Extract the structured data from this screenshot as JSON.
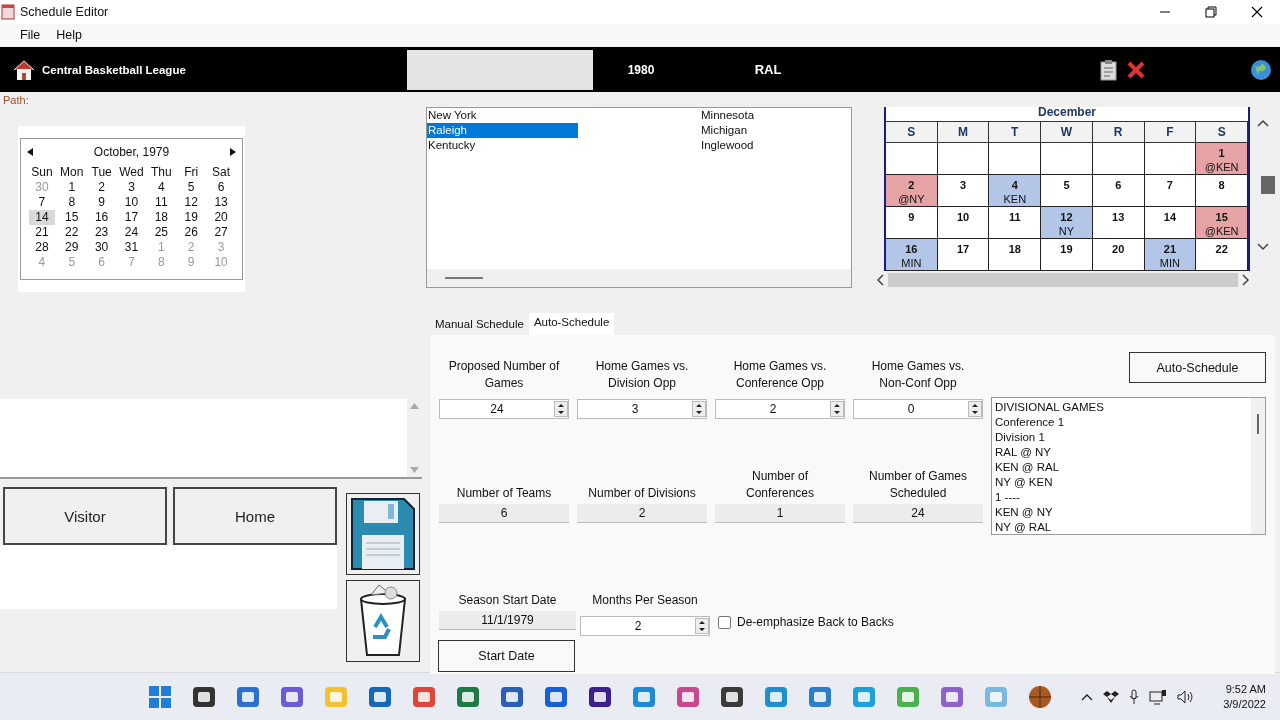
{
  "window": {
    "title": "Schedule Editor"
  },
  "menu": [
    "File",
    "Help"
  ],
  "header": {
    "league": "Central Basketball League",
    "year": "1980",
    "team": "RAL"
  },
  "path_label": "Path:",
  "mini_calendar": {
    "title": "October, 1979",
    "weekdays": [
      "Sun",
      "Mon",
      "Tue",
      "Wed",
      "Thu",
      "Fri",
      "Sat"
    ],
    "days": [
      {
        "day": "30",
        "outside_month": true,
        "selected": false
      },
      {
        "day": "1",
        "outside_month": false,
        "selected": false
      },
      {
        "day": "2",
        "outside_month": false,
        "selected": false
      },
      {
        "day": "3",
        "outside_month": false,
        "selected": false
      },
      {
        "day": "4",
        "outside_month": false,
        "selected": false
      },
      {
        "day": "5",
        "outside_month": false,
        "selected": false
      },
      {
        "day": "6",
        "outside_month": false,
        "selected": false
      },
      {
        "day": "7",
        "outside_month": false,
        "selected": false
      },
      {
        "day": "8",
        "outside_month": false,
        "selected": false
      },
      {
        "day": "9",
        "outside_month": false,
        "selected": false
      },
      {
        "day": "10",
        "outside_month": false,
        "selected": false
      },
      {
        "day": "11",
        "outside_month": false,
        "selected": false
      },
      {
        "day": "12",
        "outside_month": false,
        "selected": false
      },
      {
        "day": "13",
        "outside_month": false,
        "selected": false
      },
      {
        "day": "14",
        "outside_month": false,
        "selected": true
      },
      {
        "day": "15",
        "outside_month": false,
        "selected": false
      },
      {
        "day": "16",
        "outside_month": false,
        "selected": false
      },
      {
        "day": "17",
        "outside_month": false,
        "selected": false
      },
      {
        "day": "18",
        "outside_month": false,
        "selected": false
      },
      {
        "day": "19",
        "outside_month": false,
        "selected": false
      },
      {
        "day": "20",
        "outside_month": false,
        "selected": false
      },
      {
        "day": "21",
        "outside_month": false,
        "selected": false
      },
      {
        "day": "22",
        "outside_month": false,
        "selected": false
      },
      {
        "day": "23",
        "outside_month": false,
        "selected": false
      },
      {
        "day": "24",
        "outside_month": false,
        "selected": false
      },
      {
        "day": "25",
        "outside_month": false,
        "selected": false
      },
      {
        "day": "26",
        "outside_month": false,
        "selected": false
      },
      {
        "day": "27",
        "outside_month": false,
        "selected": false
      },
      {
        "day": "28",
        "outside_month": false,
        "selected": false
      },
      {
        "day": "29",
        "outside_month": false,
        "selected": false
      },
      {
        "day": "30",
        "outside_month": false,
        "selected": false
      },
      {
        "day": "31",
        "outside_month": false,
        "selected": false
      },
      {
        "day": "1",
        "outside_month": true,
        "selected": false
      },
      {
        "day": "2",
        "outside_month": true,
        "selected": false
      },
      {
        "day": "3",
        "outside_month": true,
        "selected": false
      },
      {
        "day": "4",
        "outside_month": true,
        "selected": false
      },
      {
        "day": "5",
        "outside_month": true,
        "selected": false
      },
      {
        "day": "6",
        "outside_month": true,
        "selected": false
      },
      {
        "day": "7",
        "outside_month": true,
        "selected": false
      },
      {
        "day": "8",
        "outside_month": true,
        "selected": false
      },
      {
        "day": "9",
        "outside_month": true,
        "selected": false
      },
      {
        "day": "10",
        "outside_month": true,
        "selected": false
      }
    ]
  },
  "team_columns": [
    [
      {
        "name": "New York",
        "selected": false
      },
      {
        "name": "Raleigh",
        "selected": true
      },
      {
        "name": "Kentucky",
        "selected": false
      }
    ],
    [
      {
        "name": "Minnesota",
        "selected": false
      },
      {
        "name": "Michigan",
        "selected": false
      },
      {
        "name": "Inglewood",
        "selected": false
      }
    ]
  ],
  "month_calendar": {
    "title": "December",
    "weekdays": [
      "S",
      "M",
      "T",
      "W",
      "R",
      "F",
      "S"
    ],
    "cells": [
      {
        "kind": "blank"
      },
      {
        "kind": "blank"
      },
      {
        "kind": "blank"
      },
      {
        "kind": "blank"
      },
      {
        "kind": "blank"
      },
      {
        "kind": "blank"
      },
      {
        "kind": "away",
        "day": "1",
        "game": "@KEN"
      },
      {
        "kind": "away",
        "day": "2",
        "game": "@NY"
      },
      {
        "kind": "open",
        "day": "3"
      },
      {
        "kind": "home",
        "day": "4",
        "game": "KEN"
      },
      {
        "kind": "open",
        "day": "5"
      },
      {
        "kind": "open",
        "day": "6"
      },
      {
        "kind": "open",
        "day": "7"
      },
      {
        "kind": "open",
        "day": "8"
      },
      {
        "kind": "open",
        "day": "9"
      },
      {
        "kind": "open",
        "day": "10"
      },
      {
        "kind": "open",
        "day": "11"
      },
      {
        "kind": "home",
        "day": "12",
        "game": "NY"
      },
      {
        "kind": "open",
        "day": "13"
      },
      {
        "kind": "open",
        "day": "14"
      },
      {
        "kind": "away",
        "day": "15",
        "game": "@KEN"
      },
      {
        "kind": "home",
        "day": "16",
        "game": "MIN"
      },
      {
        "kind": "open",
        "day": "17"
      },
      {
        "kind": "open",
        "day": "18"
      },
      {
        "kind": "open",
        "day": "19"
      },
      {
        "kind": "open",
        "day": "20"
      },
      {
        "kind": "home",
        "day": "21",
        "game": "MIN"
      },
      {
        "kind": "open",
        "day": "22"
      }
    ]
  },
  "side_buttons": [
    "Visitor",
    "Home"
  ],
  "tabs": [
    {
      "label": "Manual Schedule",
      "selected": false
    },
    {
      "label": "Auto-Schedule",
      "selected": true
    }
  ],
  "auto_schedule": {
    "spinners": [
      {
        "label": "Proposed Number of Games",
        "value": "24"
      },
      {
        "label": "Home Games vs. Division Opp",
        "value": "3"
      },
      {
        "label": "Home Games vs. Conference Opp",
        "value": "2"
      },
      {
        "label": "Home Games vs. Non-Conf Opp",
        "value": "0"
      }
    ],
    "stats": [
      {
        "label": "Number of Teams",
        "value": "6"
      },
      {
        "label": "Number of Divisions",
        "value": "2"
      },
      {
        "label": "Number of Conferences",
        "value": "1"
      },
      {
        "label": "Number of Games Scheduled",
        "value": "24"
      }
    ],
    "season_start": {
      "label": "Season Start Date",
      "value": "11/1/1979"
    },
    "months": {
      "label": "Months Per Season",
      "value": "2"
    },
    "back_to_backs": {
      "label": "De-emphasize Back to Backs",
      "checked": false
    },
    "start_date_button": "Start Date",
    "auto_schedule_button": "Auto-Schedule",
    "games": [
      "DIVISIONAL GAMES",
      "Conference 1",
      "Division 1",
      "RAL @ NY",
      "KEN @ RAL",
      "NY @ KEN",
      "1 ----",
      "KEN @ NY",
      "NY @ RAL"
    ]
  },
  "clock": {
    "time": "9:52 AM",
    "date": "3/9/2022"
  }
}
